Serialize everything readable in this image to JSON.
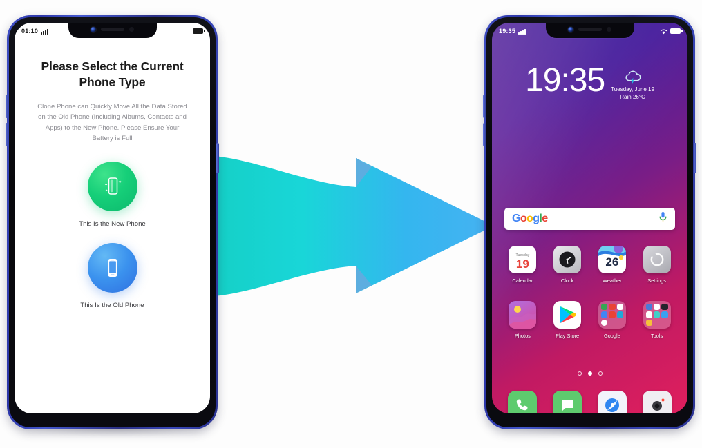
{
  "left_phone": {
    "status_bar": {
      "time": "01:10",
      "signal_icon": "signal-bars-icon",
      "battery_icon": "battery-icon"
    },
    "screen": {
      "title": "Please Select the Current Phone Type",
      "description": "Clone Phone can Quickly Move All the Data Stored on the Old Phone (Including Albums, Contacts and Apps) to the New Phone. Please Ensure Your Battery is Full",
      "options": [
        {
          "id": "new-phone",
          "label": "This Is the New Phone",
          "icon": "sparkling-phone-icon",
          "color": "#16cf79"
        },
        {
          "id": "old-phone",
          "label": "This Is the Old Phone",
          "icon": "phone-icon",
          "color": "#3b92ee"
        }
      ]
    }
  },
  "right_phone": {
    "status_bar": {
      "time": "19:35",
      "signal_icon": "signal-bars-icon",
      "wifi_icon": "wifi-icon",
      "battery_icon": "battery-icon"
    },
    "clock_widget": {
      "time": "19:35",
      "date": "Tuesday, June 19",
      "weather": "Rain 26°C",
      "weather_icon": "thunderstorm-cloud-icon"
    },
    "search_bar": {
      "logo_letters": [
        "G",
        "o",
        "o",
        "g",
        "l",
        "e"
      ],
      "mic_icon": "microphone-icon"
    },
    "app_rows": [
      [
        {
          "label": "Calendar",
          "icon": "calendar-icon",
          "day_name": "Tuesday",
          "day_number": "19"
        },
        {
          "label": "Clock",
          "icon": "clock-icon"
        },
        {
          "label": "Weather",
          "icon": "weather-icon",
          "temp": "26"
        },
        {
          "label": "Settings",
          "icon": "settings-icon"
        }
      ],
      [
        {
          "label": "Photos",
          "icon": "photos-icon"
        },
        {
          "label": "Play Store",
          "icon": "play-store-icon"
        },
        {
          "label": "Google",
          "icon": "google-folder-icon"
        },
        {
          "label": "Tools",
          "icon": "tools-folder-icon"
        }
      ]
    ],
    "page_dots": {
      "count": 3,
      "active_index": 1
    },
    "dock": [
      {
        "label": "Phone",
        "icon": "phone-handset-icon",
        "color": "#5ecb6e"
      },
      {
        "label": "Messages",
        "icon": "message-bubble-icon",
        "color": "#5ecb6e"
      },
      {
        "label": "Browser",
        "icon": "browser-icon",
        "color": "#ffffff"
      },
      {
        "label": "Camera",
        "icon": "camera-icon",
        "color": "#f0eef2"
      }
    ]
  },
  "transfer_arrow": {
    "icon": "right-arrow-icon",
    "gradient_from": "#17d3c8",
    "gradient_to": "#3fb4f0"
  },
  "colors": {
    "phone_frame": "#2f3aa8",
    "accent_green": "#16cf79",
    "accent_blue": "#3b92ee",
    "background": "#fdfdfd"
  }
}
